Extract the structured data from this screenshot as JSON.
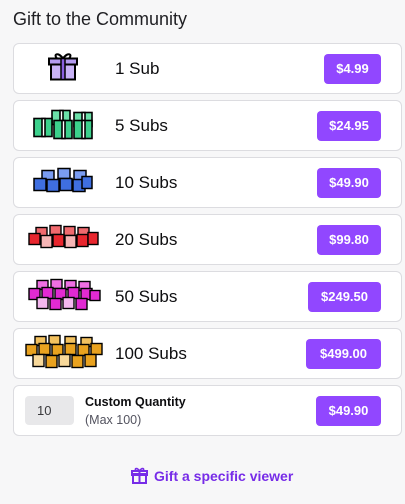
{
  "title": "Gift to the Community",
  "options": [
    {
      "label": "1 Sub",
      "price": "$4.99",
      "icon": "gift-box-purple-icon",
      "color": "#b9a0f0"
    },
    {
      "label": "5 Subs",
      "price": "$24.95",
      "icon": "gift-boxes-green-icon",
      "color": "#3cd18c"
    },
    {
      "label": "10 Subs",
      "price": "$49.90",
      "icon": "gift-boxes-blue-icon",
      "color": "#3f6fe0"
    },
    {
      "label": "20 Subs",
      "price": "$99.80",
      "icon": "gift-boxes-red-icon",
      "color": "#e8262e"
    },
    {
      "label": "50 Subs",
      "price": "$249.50",
      "icon": "gift-boxes-magenta-icon",
      "color": "#e22ad2"
    },
    {
      "label": "100 Subs",
      "price": "$499.00",
      "icon": "gift-boxes-gold-icon",
      "color": "#e9a21f"
    }
  ],
  "custom": {
    "quantity_value": "10",
    "title": "Custom Quantity",
    "subtitle": "(Max 100)",
    "price": "$49.90"
  },
  "specific_viewer": {
    "label": "Gift a specific viewer",
    "icon": "gift-icon"
  },
  "colors": {
    "accent": "#9147ff",
    "link": "#772ce8"
  }
}
